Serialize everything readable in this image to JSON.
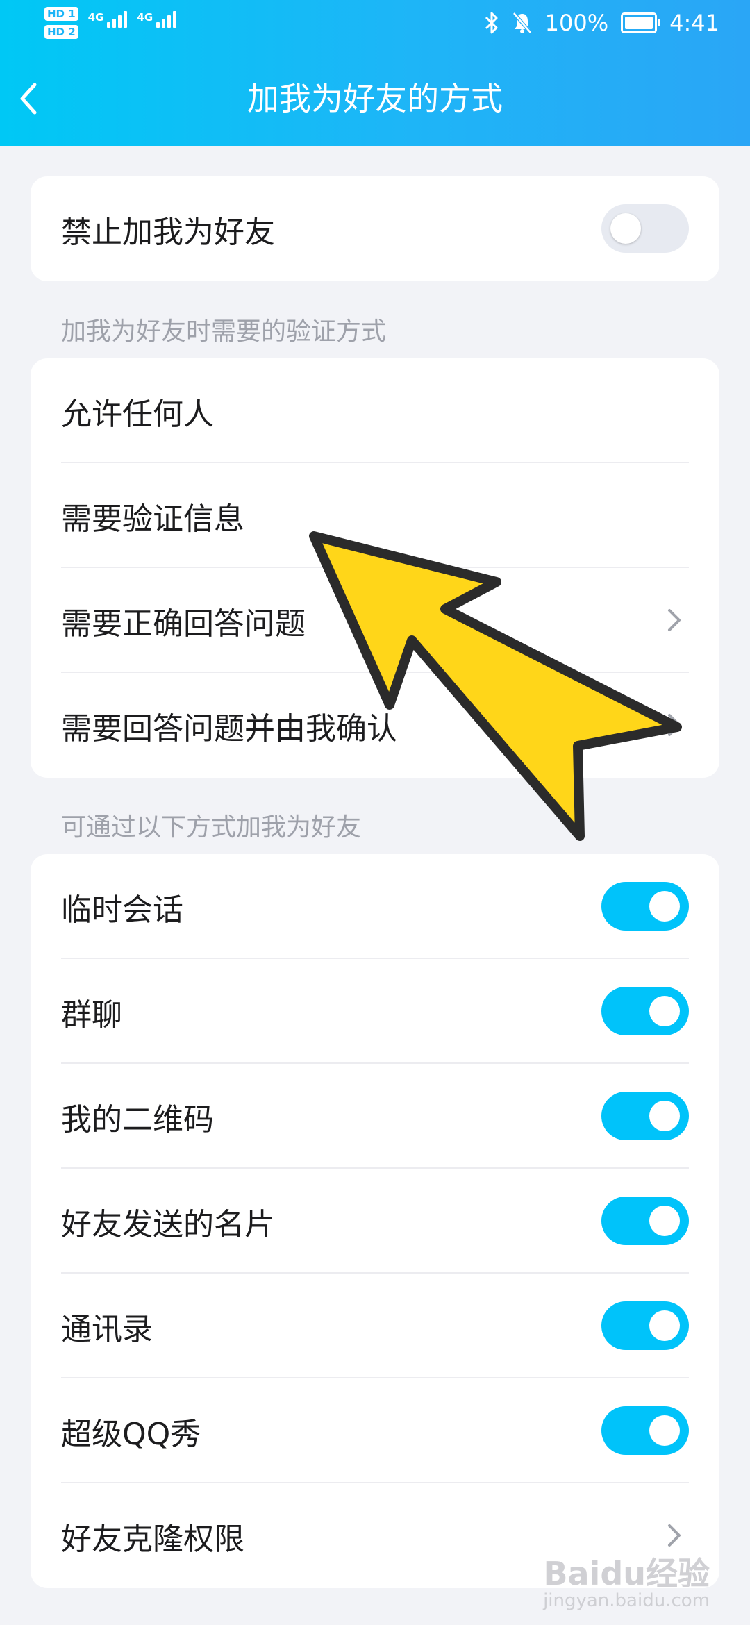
{
  "status_bar": {
    "hd1": "HD 1",
    "hd2": "HD 2",
    "sig1": "4G",
    "sig2": "4G",
    "battery": "100%",
    "time": "4:41",
    "icons": [
      "bluetooth-icon",
      "bell-mute-icon",
      "battery-icon"
    ]
  },
  "header": {
    "title": "加我为好友的方式",
    "back_icon": "chevron-left-icon"
  },
  "card_block": {
    "label": "禁止加我为好友",
    "toggle_on": false
  },
  "verify_section": {
    "title": "加我为好友时需要的验证方式",
    "items": [
      {
        "label": "允许任何人",
        "chevron": false
      },
      {
        "label": "需要验证信息",
        "chevron": false
      },
      {
        "label": "需要正确回答问题",
        "chevron": true
      },
      {
        "label": "需要回答问题并由我确认",
        "chevron": true
      }
    ]
  },
  "source_section": {
    "title": "可通过以下方式加我为好友",
    "items": [
      {
        "label": "临时会话",
        "toggle_on": true
      },
      {
        "label": "群聊",
        "toggle_on": true
      },
      {
        "label": "我的二维码",
        "toggle_on": true
      },
      {
        "label": "好友发送的名片",
        "toggle_on": true
      },
      {
        "label": "通讯录",
        "toggle_on": true
      },
      {
        "label": "超级QQ秀",
        "toggle_on": true
      },
      {
        "label": "好友克隆权限",
        "toggle_on": null,
        "chevron": true
      }
    ]
  },
  "colors": {
    "accent": "#00c3fa",
    "header_start": "#00c8f5",
    "header_end": "#2aa6f6",
    "background": "#f2f3f7",
    "annotation_arrow": "#ffd619"
  },
  "watermark": {
    "text": "Baidu经验",
    "url": "jingyan.baidu.com"
  }
}
